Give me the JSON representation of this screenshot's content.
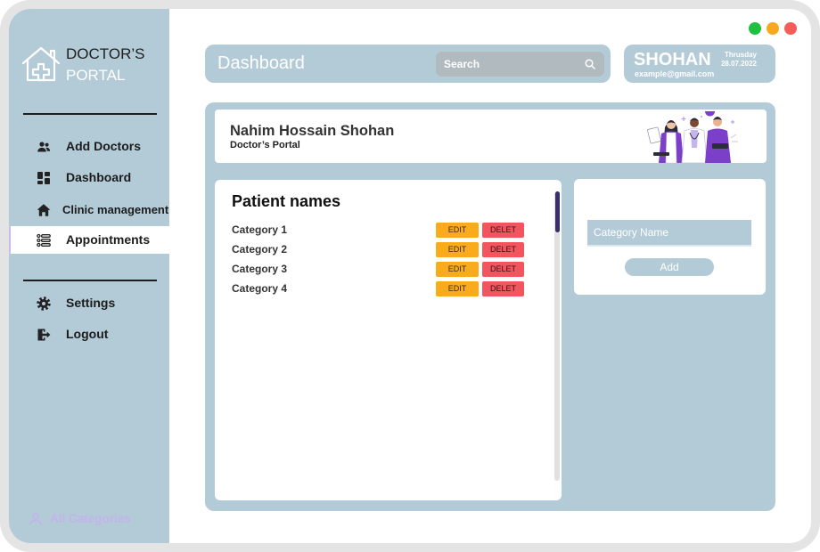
{
  "window_controls": {
    "colors": [
      "#1fbf3f",
      "#f6a91e",
      "#f55d5b"
    ]
  },
  "theme": {
    "accent": "#b3cad7",
    "edit": "#f9ab1c",
    "delete": "#f2555d",
    "scroll_thumb": "#3b2e6e"
  },
  "brand": {
    "line1": "DOCTOR’S",
    "line2": "PORTAL",
    "icon": "hospital-house-icon"
  },
  "sidebar": {
    "items": [
      {
        "label": "Add Doctors",
        "icon": "users-icon",
        "active": false
      },
      {
        "label": "Dashboard",
        "icon": "dashboard-grid-icon",
        "active": false
      },
      {
        "label": "Clinic management",
        "icon": "home-icon",
        "active": false
      },
      {
        "label": "Appointments",
        "icon": "list-icon",
        "active": true
      }
    ],
    "secondary_items": [
      {
        "label": "Settings",
        "icon": "gear-icon"
      },
      {
        "label": "Logout",
        "icon": "logout-icon"
      }
    ],
    "footer": {
      "label": "All Categories",
      "icon": "user-icon"
    }
  },
  "header": {
    "title": "Dashboard",
    "search_placeholder": "Search",
    "search_icon": "search-icon"
  },
  "user": {
    "name": "SHOHAN",
    "day": "Thrusday",
    "date": "28.07.2022",
    "email": "example@gmail.com"
  },
  "welcome": {
    "name": "Nahim Hossain Shohan",
    "subtitle": "Doctor’s Portal",
    "illustration": "doctors-illustration"
  },
  "patients": {
    "title": "Patient names",
    "edit_label": "EDIT",
    "delete_label": "DELET",
    "rows": [
      "Category 1",
      "Category 2",
      "Category 3",
      "Category 4"
    ]
  },
  "add_form": {
    "placeholder": "Category Name",
    "button_label": "Add"
  }
}
